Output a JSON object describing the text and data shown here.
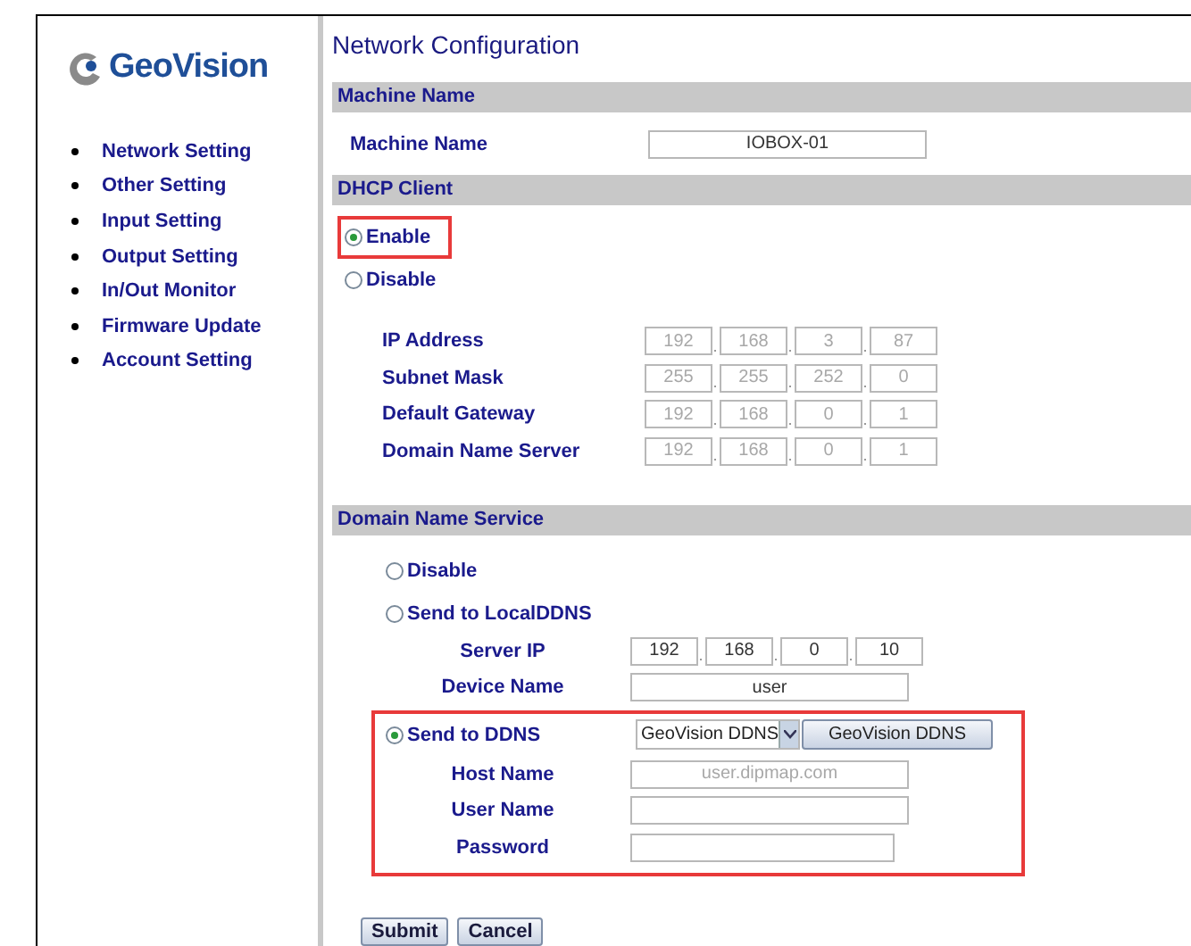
{
  "logo": {
    "text": "GeoVision"
  },
  "nav": [
    "Network Setting",
    "Other Setting",
    "Input Setting",
    "Output Setting",
    "In/Out Monitor",
    "Firmware Update",
    "Account Setting"
  ],
  "title": "Network Configuration",
  "machine": {
    "header": "Machine Name",
    "label": "Machine Name",
    "value": "IOBOX-01"
  },
  "dhcp": {
    "header": "DHCP Client",
    "options": [
      {
        "label": "Enable",
        "selected": true,
        "highlighted": true
      },
      {
        "label": "Disable",
        "selected": false,
        "highlighted": false
      }
    ],
    "fields": [
      {
        "label": "IP Address",
        "octets": [
          "192",
          "168",
          "3",
          "87"
        ],
        "disabled": true
      },
      {
        "label": "Subnet Mask",
        "octets": [
          "255",
          "255",
          "252",
          "0"
        ],
        "disabled": true
      },
      {
        "label": "Default Gateway",
        "octets": [
          "192",
          "168",
          "0",
          "1"
        ],
        "disabled": true
      },
      {
        "label": "Domain Name Server",
        "octets": [
          "192",
          "168",
          "0",
          "1"
        ],
        "disabled": true
      }
    ]
  },
  "dns": {
    "header": "Domain Name Service",
    "options": [
      {
        "label": "Disable",
        "selected": false,
        "highlighted": false
      },
      {
        "label": "Send to LocalDDNS",
        "selected": false,
        "highlighted": false,
        "fields": [
          {
            "kind": "ip",
            "label": "Server IP",
            "octets": [
              "192",
              "168",
              "0",
              "10"
            ]
          },
          {
            "kind": "text",
            "label": "Device Name",
            "value": "user"
          }
        ]
      },
      {
        "label": "Send to DDNS",
        "selected": true,
        "highlighted": true,
        "select": {
          "value": "GeoVision DDNS",
          "button": "GeoVision DDNS"
        },
        "fields": [
          {
            "kind": "text",
            "label": "Host Name",
            "placeholder": "user.dipmap.com"
          },
          {
            "kind": "text",
            "label": "User Name"
          },
          {
            "kind": "text",
            "label": "Password",
            "short": true
          }
        ]
      }
    ]
  },
  "buttons": [
    "Submit",
    "Cancel"
  ]
}
